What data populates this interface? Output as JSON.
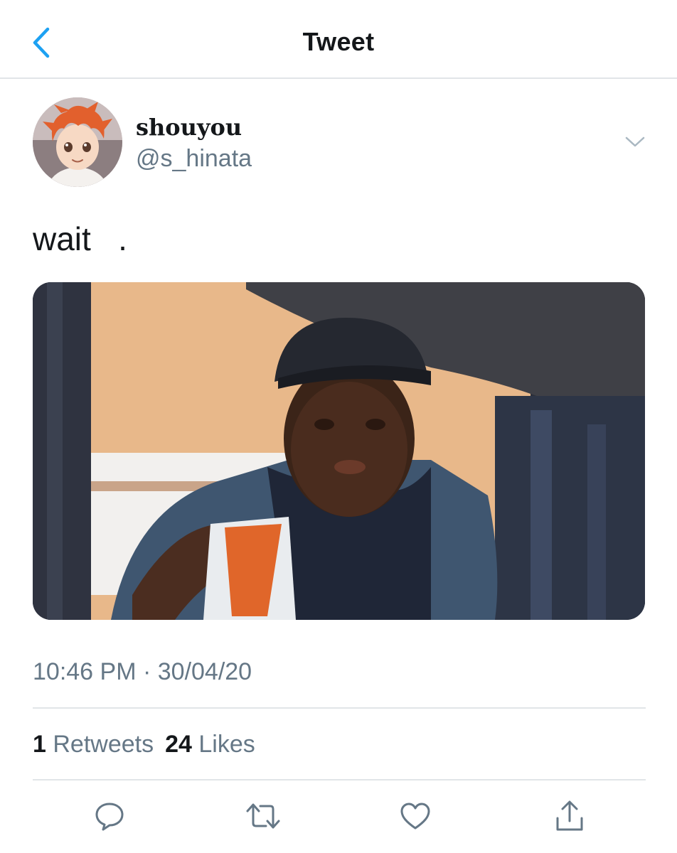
{
  "header": {
    "title": "Tweet",
    "back_icon": "chevron-left-icon",
    "accent_color": "#1da1f2"
  },
  "author": {
    "name": "shouyou",
    "handle": "@s_hinata",
    "avatar_icon": "anime-character-avatar",
    "menu_icon": "chevron-down-icon"
  },
  "tweet": {
    "text": "wait   .",
    "media_description_icon": "photo-drive-thru-worker",
    "timestamp": "10:46 PM · 30/04/20"
  },
  "stats": {
    "retweets_count": "1",
    "retweets_label": "Retweets",
    "likes_count": "24",
    "likes_label": "Likes"
  },
  "actions": {
    "reply_icon": "reply-icon",
    "retweet_icon": "retweet-icon",
    "like_icon": "heart-icon",
    "share_icon": "share-icon"
  },
  "colors": {
    "text_primary": "#14171a",
    "text_secondary": "#657786",
    "divider": "#e1e5e8"
  }
}
